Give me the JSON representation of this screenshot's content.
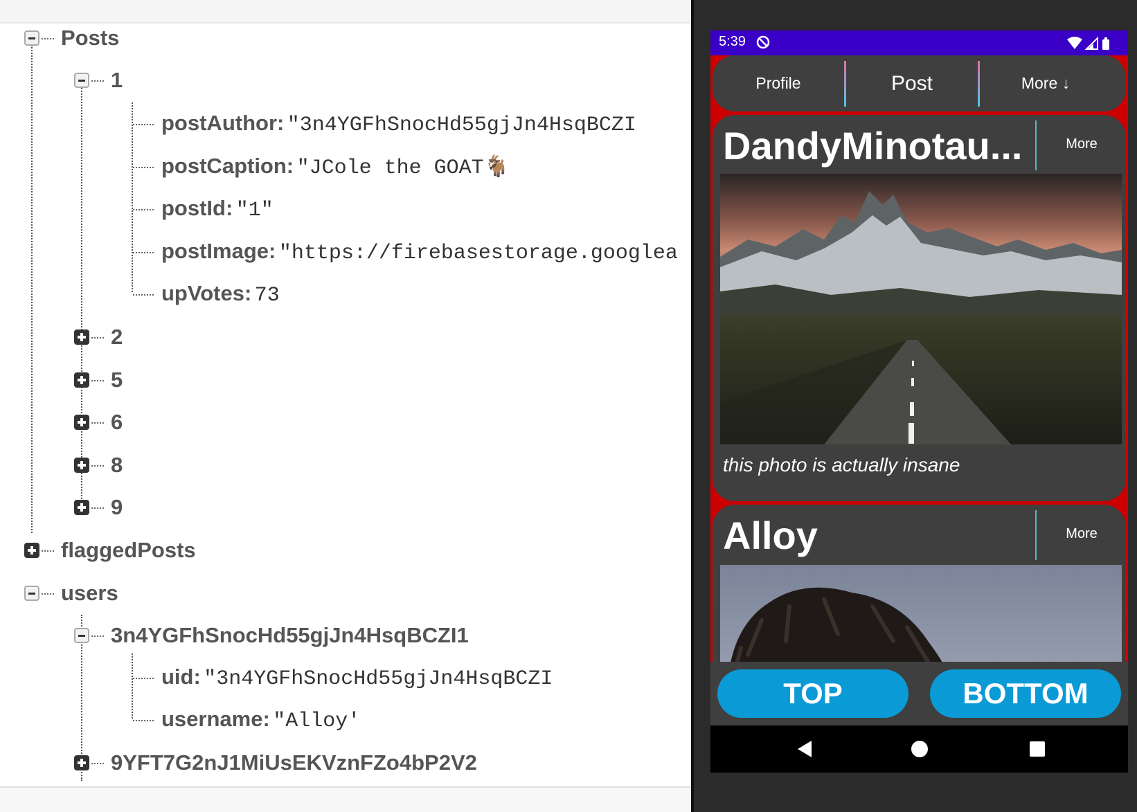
{
  "database_tree": {
    "posts_node": "Posts",
    "post_1": {
      "key": "1",
      "fields": [
        {
          "key": "postAuthor:",
          "value": "\"3n4YGFhSnocHd55gjJn4HsqBCZI"
        },
        {
          "key": "postCaption:",
          "value": "\"JCole the GOAT🐐"
        },
        {
          "key": "postId:",
          "value": "\"1\""
        },
        {
          "key": "postImage:",
          "value": "\"https://firebasestorage.googlea"
        },
        {
          "key": "upVotes:",
          "value": "73"
        }
      ]
    },
    "collapsed_posts": [
      "2",
      "5",
      "6",
      "8",
      "9"
    ],
    "flagged_node": "flaggedPosts",
    "users_node": "users",
    "user_1": {
      "key": "3n4YGFhSnocHd55gjJn4HsqBCZI1",
      "fields": [
        {
          "key": "uid:",
          "value": "\"3n4YGFhSnocHd55gjJn4HsqBCZI"
        },
        {
          "key": "username:",
          "value": "\"Alloy'"
        }
      ]
    },
    "user_2": {
      "key": "9YFT7G2nJ1MiUsEKVznFZo4bP2V2"
    }
  },
  "phone": {
    "status_time": "5:39",
    "nav": {
      "profile": "Profile",
      "post": "Post",
      "more": "More ↓"
    },
    "posts": [
      {
        "username": "DandyMinotau...",
        "more": "More",
        "caption": "this photo is actually insane"
      },
      {
        "username": "Alloy",
        "more": "More"
      }
    ],
    "buttons": {
      "top": "TOP",
      "bottom": "BOTTOM"
    },
    "icons": [
      "do-not-disturb-icon",
      "wifi-icon",
      "signal-icon",
      "battery-icon",
      "back-icon",
      "home-icon",
      "recents-icon"
    ]
  },
  "colors": {
    "status_bar": "#3b00c7",
    "app_background": "#cc0000",
    "card": "#3f3f3f",
    "button_blue": "#0a9ad6"
  }
}
